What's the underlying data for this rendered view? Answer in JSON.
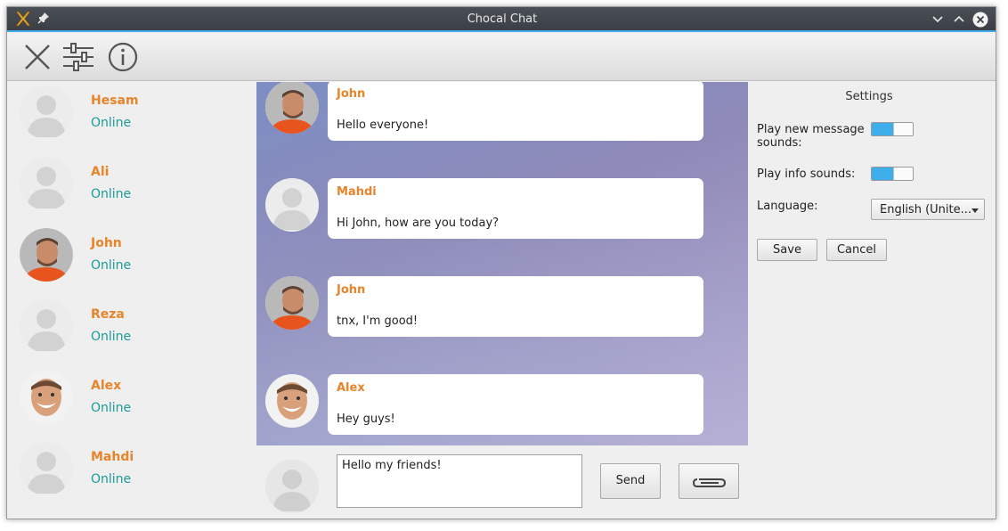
{
  "window": {
    "title": "Chocal Chat"
  },
  "toolbar": {
    "icons": [
      "close-icon",
      "settings-sliders-icon",
      "info-icon"
    ]
  },
  "contacts": [
    {
      "name": "Hesam",
      "status": "Online",
      "avatar": "placeholder"
    },
    {
      "name": "Ali",
      "status": "Online",
      "avatar": "placeholder"
    },
    {
      "name": "John",
      "status": "Online",
      "avatar": "photo"
    },
    {
      "name": "Reza",
      "status": "Online",
      "avatar": "placeholder"
    },
    {
      "name": "Alex",
      "status": "Online",
      "avatar": "photo"
    },
    {
      "name": "Mahdi",
      "status": "Online",
      "avatar": "placeholder"
    }
  ],
  "messages": [
    {
      "sender": "John",
      "text": "Hello everyone!",
      "avatar": "photo"
    },
    {
      "sender": "Mahdi",
      "text": "Hi John, how are you today?",
      "avatar": "placeholder"
    },
    {
      "sender": "John",
      "text": "tnx, I'm good!",
      "avatar": "photo"
    },
    {
      "sender": "Alex",
      "text": "Hey guys!",
      "avatar": "photo"
    }
  ],
  "composer": {
    "value": "Hello my friends!",
    "send_label": "Send",
    "attach_icon": "paperclip-icon"
  },
  "settings": {
    "title": "Settings",
    "play_new_message_label": "Play new message sounds:",
    "play_new_message_on": true,
    "play_info_label": "Play info sounds:",
    "play_info_on": true,
    "language_label": "Language:",
    "language_value": "English (Unite...",
    "save_label": "Save",
    "cancel_label": "Cancel"
  },
  "colors": {
    "accent": "#3daee9",
    "name": "#e8842a",
    "status": "#1a9a9a",
    "titlebar": "#40444b"
  }
}
